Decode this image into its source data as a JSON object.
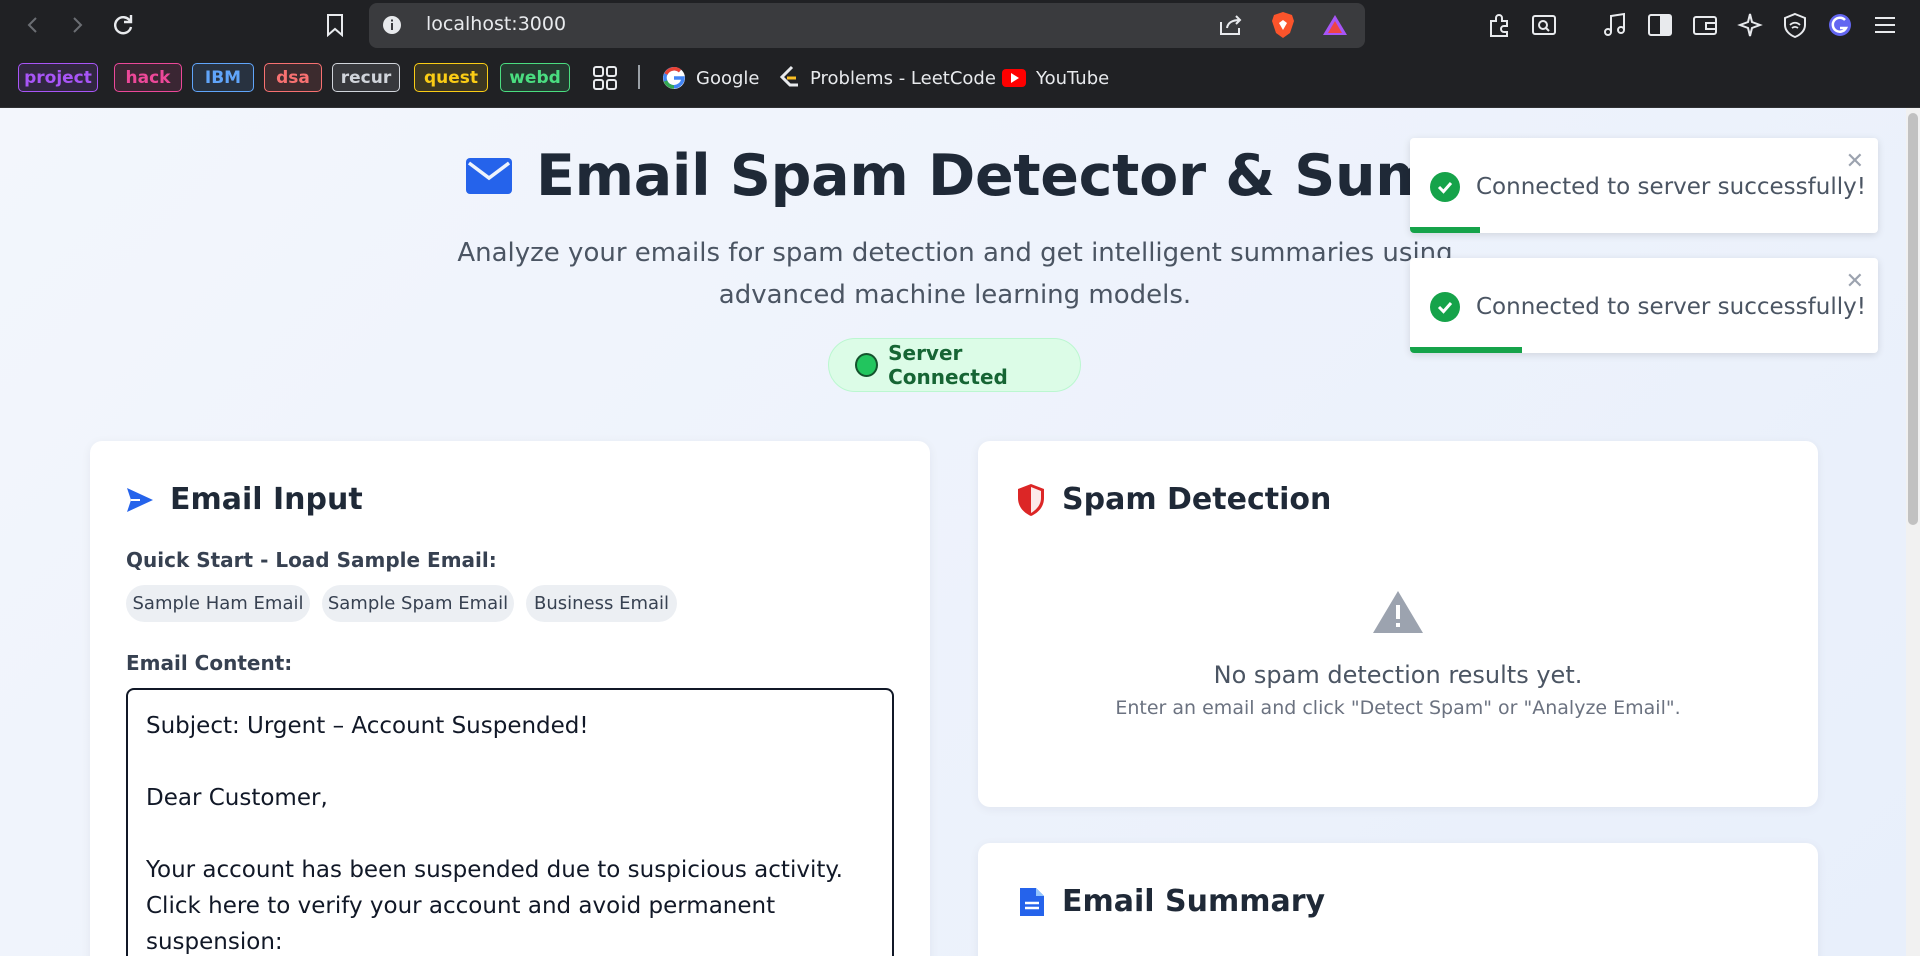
{
  "browser": {
    "url": "localhost:3000",
    "bookmark_tags": [
      {
        "label": "project",
        "color": "#a855f7"
      },
      {
        "label": "hack",
        "color": "#ec4899"
      },
      {
        "label": "IBM",
        "color": "#60a5fa"
      },
      {
        "label": "dsa",
        "color": "#f87171"
      },
      {
        "label": "recur",
        "color": "#d1d5db"
      },
      {
        "label": "quest",
        "color": "#facc15"
      },
      {
        "label": "webd",
        "color": "#4ade80"
      }
    ],
    "bookmark_links": [
      {
        "label": "Google",
        "icon": "google-icon"
      },
      {
        "label": "Problems - LeetCode",
        "icon": "leetcode-icon"
      },
      {
        "label": "YouTube",
        "icon": "youtube-icon"
      }
    ]
  },
  "hero": {
    "title": "Email Spam Detector & Summarizer",
    "subtitle": "Analyze your emails for spam detection and get intelligent summaries using advanced machine learning models.",
    "status": "Server Connected",
    "status_color": "#22c55e"
  },
  "email_input": {
    "title": "Email Input",
    "quick_start_label": "Quick Start - Load Sample Email:",
    "samples": [
      "Sample Ham Email",
      "Sample Spam Email",
      "Business Email"
    ],
    "content_label": "Email Content:",
    "content": "Subject: Urgent – Account Suspended!\n\nDear Customer,\n\nYour account has been suspended due to suspicious activity.\nClick here to verify your account and avoid permanent suspension:\nhttp://phishingsite.com"
  },
  "spam_detection": {
    "title": "Spam Detection",
    "empty_title": "No spam detection results yet.",
    "empty_hint": "Enter an email and click \"Detect Spam\" or \"Analyze Email\"."
  },
  "email_summary": {
    "title": "Email Summary"
  },
  "toasts": [
    {
      "message": "Connected to server successfully!",
      "progress": 0.15
    },
    {
      "message": "Connected to server successfully!",
      "progress": 0.24
    }
  ],
  "colors": {
    "accent_blue": "#2563eb",
    "danger_red": "#dc2626",
    "success_green": "#16a34a"
  }
}
